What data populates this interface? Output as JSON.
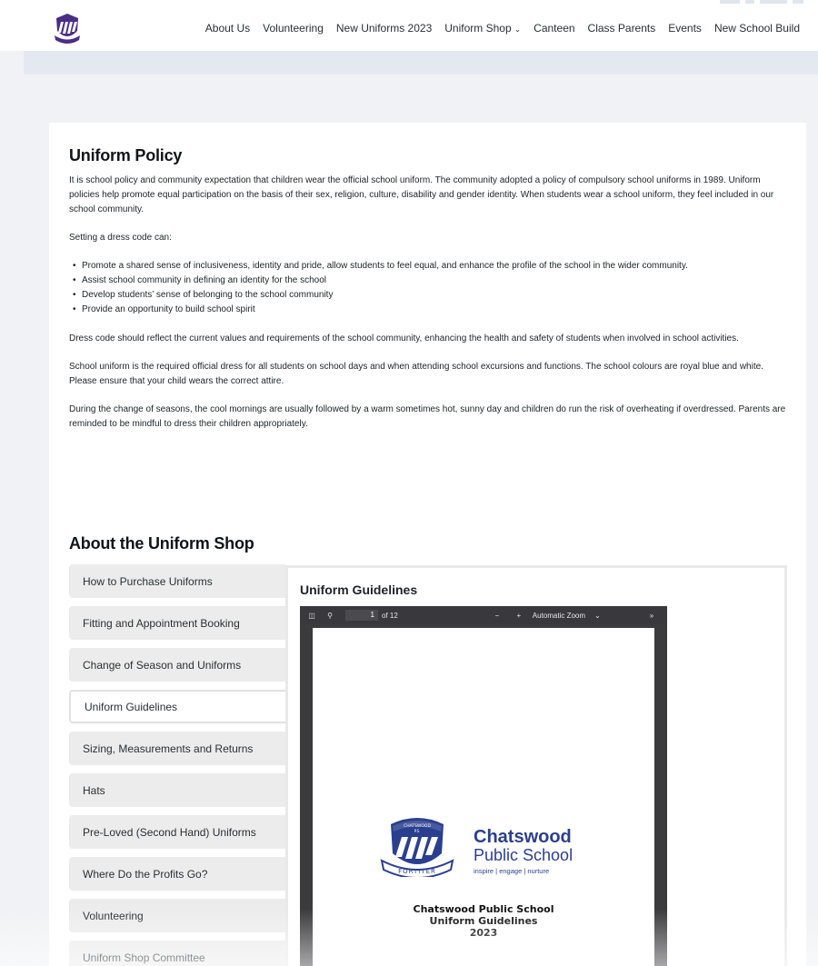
{
  "header": {
    "nav": [
      {
        "label": "About Us"
      },
      {
        "label": "Volunteering"
      },
      {
        "label": "New Uniforms 2023"
      },
      {
        "label": "Uniform Shop",
        "has_dropdown": true
      },
      {
        "label": "Canteen"
      },
      {
        "label": "Class Parents"
      },
      {
        "label": "Events"
      },
      {
        "label": "New School Build"
      }
    ]
  },
  "policy": {
    "title": "Uniform Policy",
    "p1": "It is school policy and community expectation that children wear the official school uniform. The community adopted a policy of compulsory school uniforms in 1989. Uniform policies help promote equal participation on the basis of their sex, religion, culture, disability and gender identity. When students wear a school uniform, they feel included in our school community.",
    "p2": "Setting a dress code can:",
    "bullets": [
      "Promote a shared sense of inclusiveness, identity and pride, allow students to feel equal, and enhance the profile of the school in the wider community.",
      "Assist school community in defining an identity for the school",
      "Develop students’ sense of belonging to the school community",
      "Provide an opportunity to build school spirit"
    ],
    "p3": "Dress code should reflect the current values and requirements of the school community, enhancing the health and safety of students when involved in school activities.",
    "p4": "School uniform is the required official dress for all students on school days and when attending school excursions and functions. The school colours are royal blue and white. Please ensure that your child wears the correct attire.",
    "p5": "During the change of seasons, the cool mornings are usually followed by a warm sometimes hot, sunny day and children do run the risk of overheating if overdressed. Parents are reminded to be mindful to dress their children appropriately."
  },
  "shop": {
    "title": "About the Uniform Shop",
    "tabs": [
      "How to Purchase Uniforms",
      "Fitting and Appointment Booking",
      "Change of Season and Uniforms",
      "Uniform Guidelines",
      "Sizing, Measurements and Returns",
      "Hats",
      "Pre-Loved (Second Hand) Uniforms",
      "Where Do the Profits Go?",
      "Volunteering",
      "Uniform Shop Committee"
    ],
    "active_tab": "Uniform Guidelines",
    "panel_title": "Uniform Guidelines"
  },
  "pdf": {
    "page": "1",
    "of": "of 12",
    "zoom": "Automatic Zoom",
    "brand_line1": "Chatswood",
    "brand_line2": "Public School",
    "tagline": "inspire | engage | nurture",
    "crest_top": "CHATSWOOD",
    "crest_sub": "P.S.",
    "crest_motto": "FORTITER",
    "doc_title_1": "Chatswood Public School",
    "doc_title_2": "Uniform Guidelines",
    "doc_title_3": "2023"
  },
  "colors": {
    "brand_blue": "#2a3f8f",
    "crest_purple": "#4b2c86",
    "band": "#e4e9f1",
    "tab_bg": "#ececec"
  }
}
